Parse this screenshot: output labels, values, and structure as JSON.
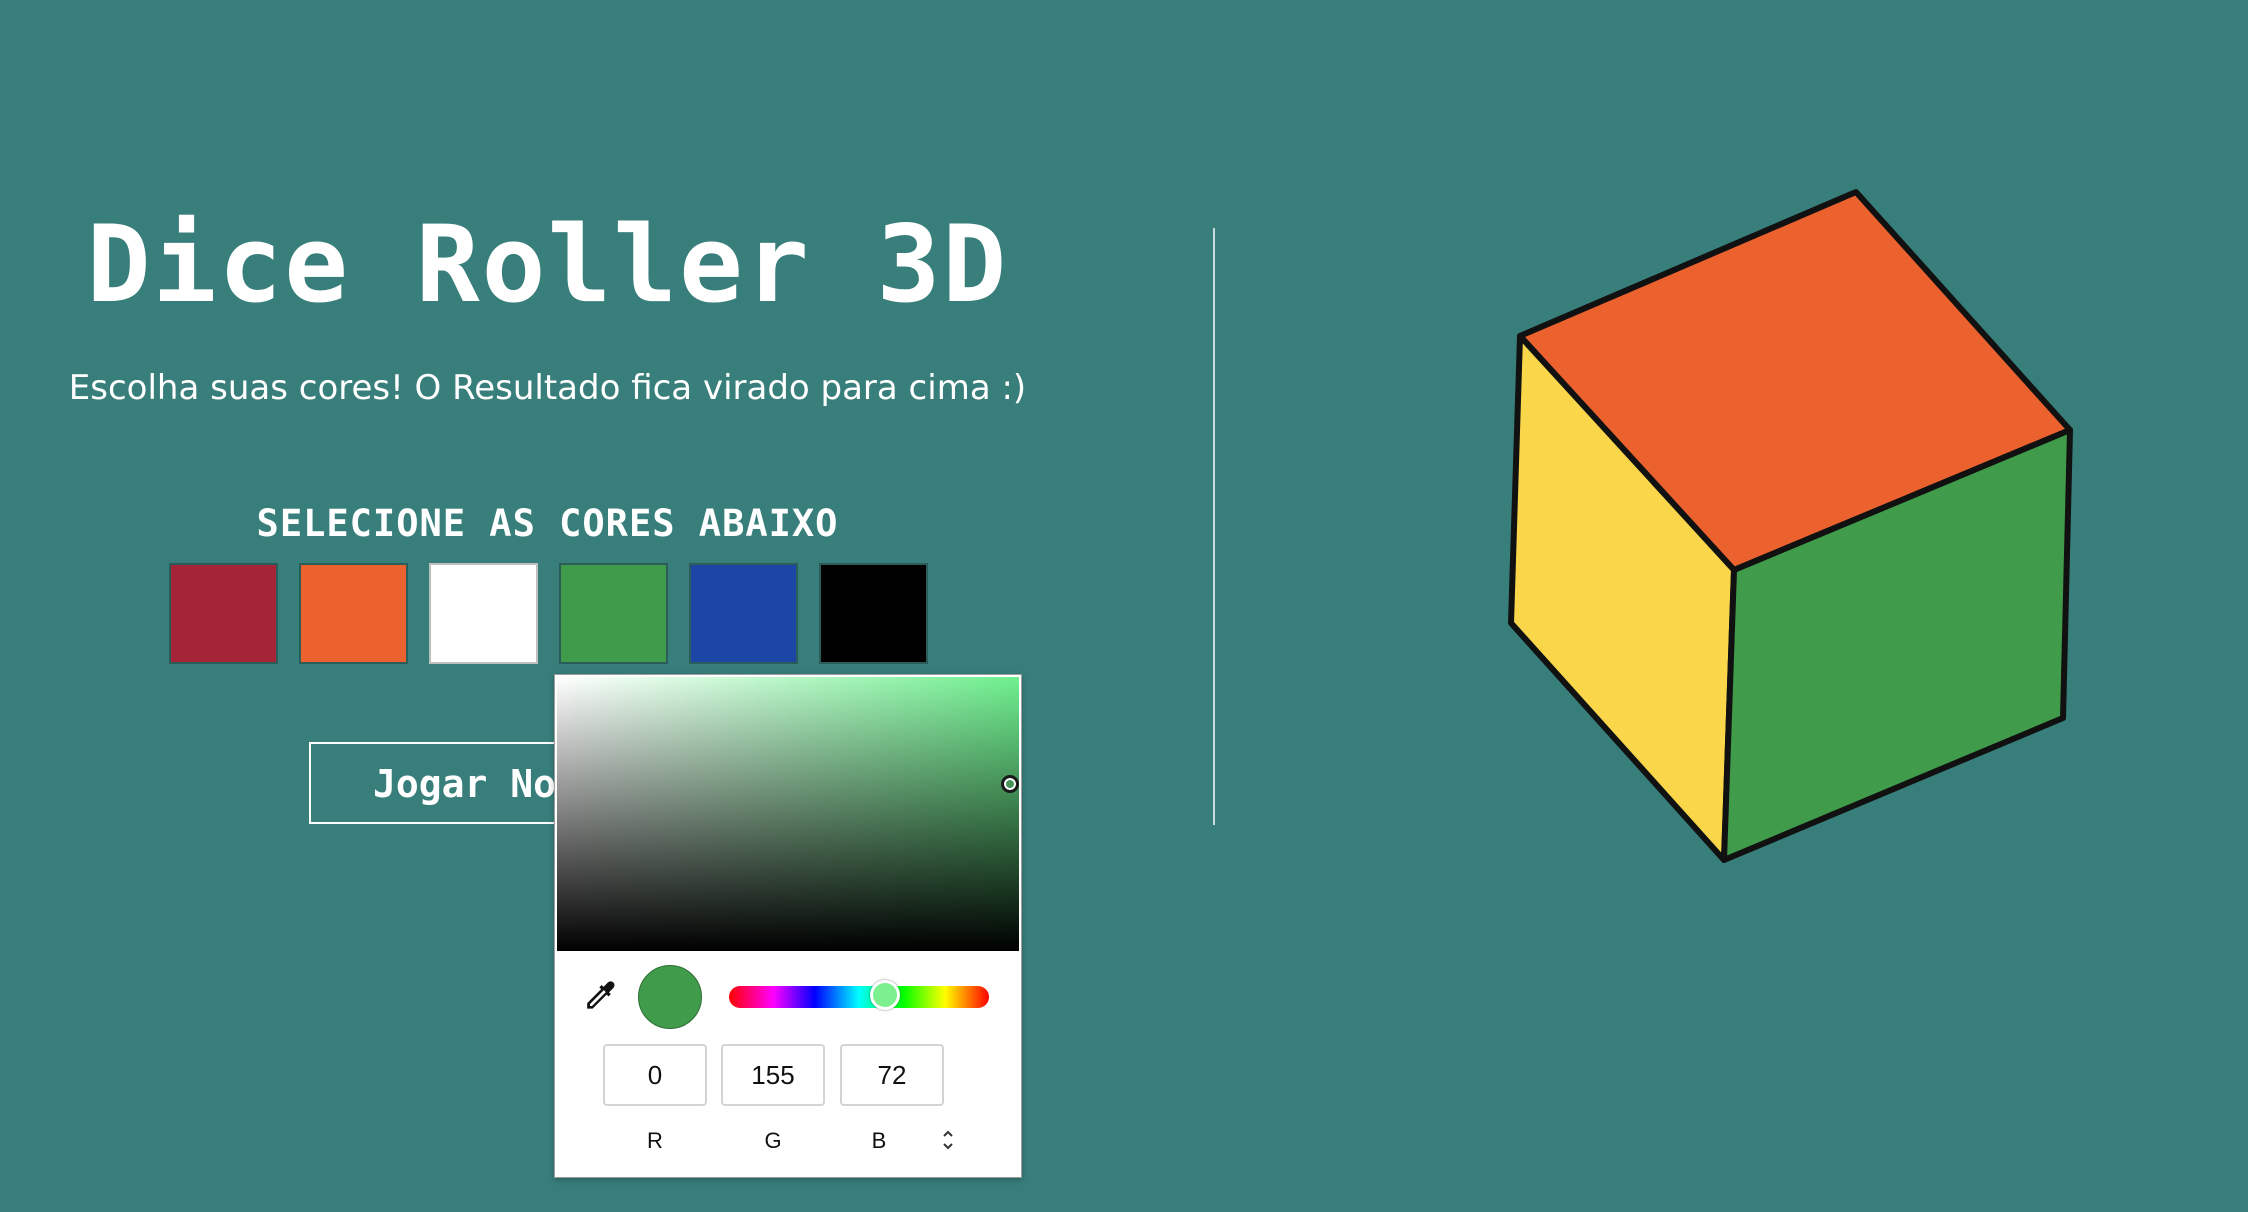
{
  "app": {
    "title": "Dice Roller 3D",
    "subtitle": "Escolha suas cores! O Resultado fica virado para cima :)"
  },
  "colors_section": {
    "title": "SELECIONE AS CORES ABAIXO",
    "swatches": [
      {
        "name": "red",
        "color": "#a52437"
      },
      {
        "name": "orange",
        "color": "#ec622f"
      },
      {
        "name": "white",
        "color": "#ffffff"
      },
      {
        "name": "green",
        "color": "#409b4a"
      },
      {
        "name": "blue",
        "color": "#1b46a5"
      },
      {
        "name": "black",
        "color": "#000000"
      }
    ]
  },
  "play_button": {
    "label": "Jogar Novamente"
  },
  "color_picker": {
    "selected_color": "#409b4a",
    "hue_color": "#6ff08f",
    "r": "0",
    "g": "155",
    "b": "72",
    "r_label": "R",
    "g_label": "G",
    "b_label": "B",
    "icons": [
      "eyedropper-icon",
      "chevron-up-down-icon"
    ]
  },
  "dice": {
    "top_face_color": "#ec622f",
    "left_face_color": "#f9d64a",
    "right_face_color": "#409b4a",
    "outline_color": "#111111"
  },
  "page": {
    "background_color": "#387f7c"
  }
}
